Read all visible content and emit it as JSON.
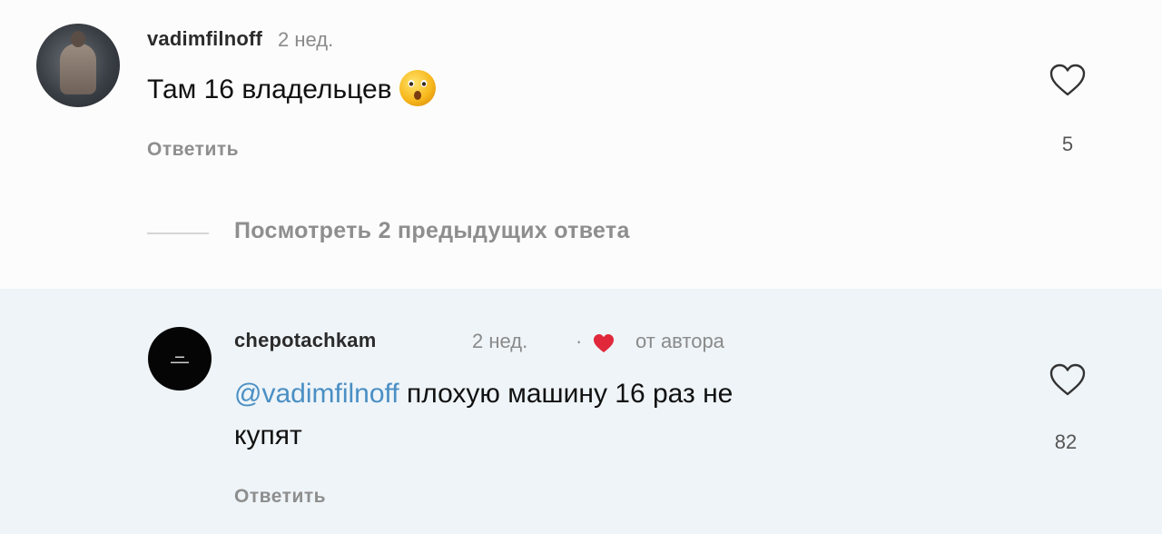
{
  "comment": {
    "username": "vadimfilnoff",
    "time": "2 нед.",
    "text": "Там 16 владельцев",
    "emoji_icon": "astonished-face-emoji",
    "reply_label": "Ответить",
    "likes": "5"
  },
  "view_replies": "Посмотреть 2 предыдущих ответа",
  "reply": {
    "username": "chepotachkam",
    "time": "2 нед.",
    "separator": "·",
    "author_label": "от автора",
    "mention": "@vadimfilnoff",
    "text_line1": " плохую машину 16 раз не",
    "text_line2": "купят",
    "reply_label": "Ответить",
    "likes": "82"
  },
  "colors": {
    "mention": "#4a8fc4",
    "author_heart": "#e0283a",
    "reply_background": "#eef4f8"
  }
}
